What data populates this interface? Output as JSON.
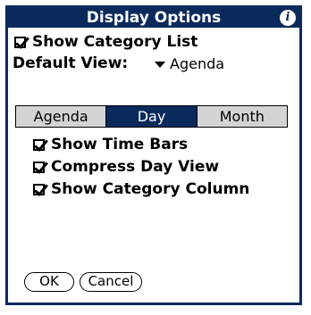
{
  "dialog": {
    "title": "Display Options",
    "info_icon": "info-icon"
  },
  "show_category_list": {
    "label": "Show Category List",
    "checked": true
  },
  "default_view": {
    "label": "Default View:",
    "value": "Agenda"
  },
  "views": {
    "tabs": [
      "Agenda",
      "Day",
      "Month"
    ],
    "selected": "Day"
  },
  "day_options": [
    {
      "label": "Show Time Bars",
      "checked": true
    },
    {
      "label": "Compress Day View",
      "checked": true
    },
    {
      "label": "Show Category Column",
      "checked": true
    }
  ],
  "buttons": {
    "ok": "OK",
    "cancel": "Cancel"
  },
  "colors": {
    "accent": "#0a2a5c",
    "push_bg": "#d4d4d4"
  }
}
